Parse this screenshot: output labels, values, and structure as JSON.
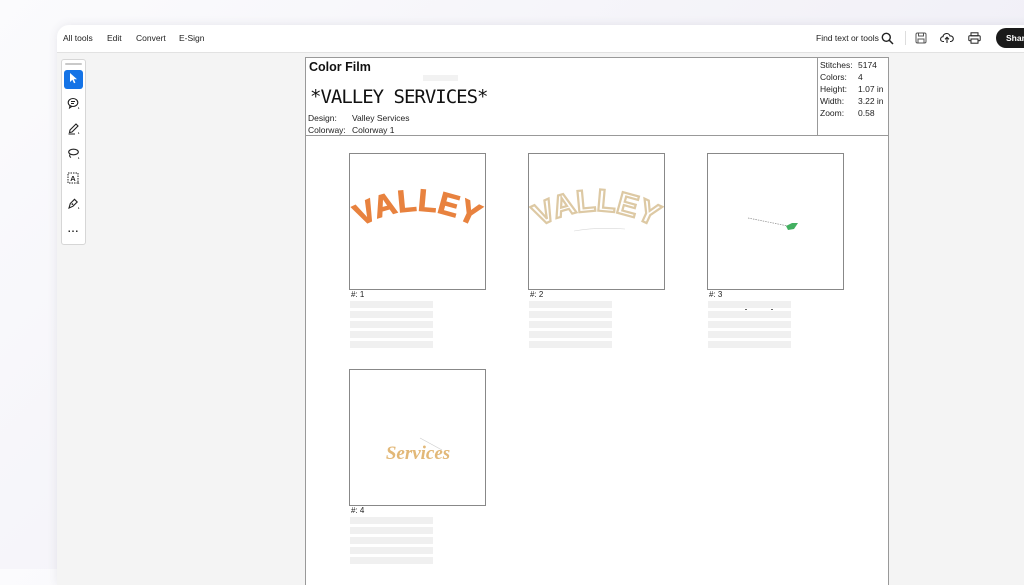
{
  "toolbar": {
    "menus": [
      "All tools",
      "Edit",
      "Convert",
      "E-Sign"
    ],
    "find_label": "Find text or tools",
    "share_label": "Share",
    "icons": [
      "search-icon",
      "save-icon",
      "upload-cloud-icon",
      "print-icon"
    ]
  },
  "tools_panel": {
    "items": [
      "select-arrow-icon",
      "comment-icon",
      "pen-icon",
      "lasso-icon",
      "text-box-icon",
      "signature-pen-icon",
      "more-icon"
    ],
    "more_label": "..."
  },
  "document": {
    "title": "Color Film",
    "design_name_large": "*VALLEY SERVICES*",
    "design_label": "Design:",
    "design_value": "Valley Services",
    "colorway_label": "Colorway:",
    "colorway_value": "Colorway 1",
    "stats": [
      {
        "label": "Stitches:",
        "value": "5174"
      },
      {
        "label": "Colors:",
        "value": "4"
      },
      {
        "label": "Height:",
        "value": "1.07 in"
      },
      {
        "label": "Width:",
        "value": "3.22 in"
      },
      {
        "label": "Zoom:",
        "value": "0.58"
      }
    ],
    "films": [
      {
        "caption": "#: 1",
        "art_text": "VALLEY",
        "color": "#e8823f"
      },
      {
        "caption": "#: 2",
        "art_text": "VALLEY",
        "color": "#ddc9a4"
      },
      {
        "caption": "#: 3",
        "art_text": "",
        "color": "#43b061"
      },
      {
        "caption": "#: 4",
        "art_text": "Services",
        "color": "#e2b878"
      }
    ]
  }
}
